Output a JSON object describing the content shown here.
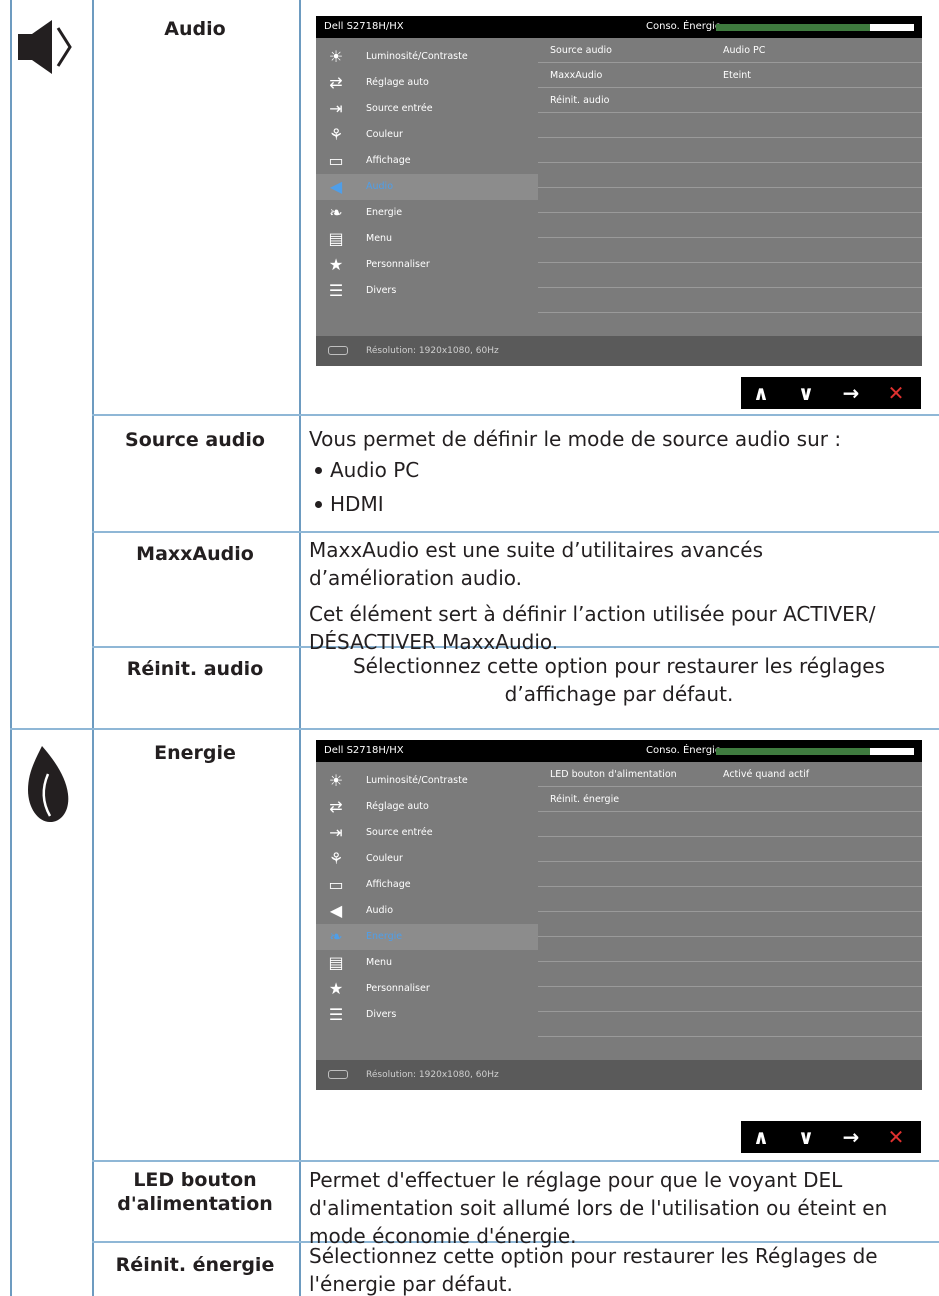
{
  "audio_section": {
    "title": "Audio",
    "osd": {
      "model": "Dell S2718H/HX",
      "energy_label": "Conso. Énergie",
      "energy_level": 0.78,
      "menu_items": [
        {
          "icon": "brightness-icon",
          "label": "Luminosité/Contraste"
        },
        {
          "icon": "auto-adjust-icon",
          "label": "Réglage auto"
        },
        {
          "icon": "input-source-icon",
          "label": "Source entrée"
        },
        {
          "icon": "color-icon",
          "label": "Couleur"
        },
        {
          "icon": "display-icon",
          "label": "Affichage"
        },
        {
          "icon": "speaker-icon",
          "label": "Audio"
        },
        {
          "icon": "energy-icon",
          "label": "Energie"
        },
        {
          "icon": "menu-icon",
          "label": "Menu"
        },
        {
          "icon": "star-icon",
          "label": "Personnaliser"
        },
        {
          "icon": "others-icon",
          "label": "Divers"
        }
      ],
      "active_index": 5,
      "settings": [
        {
          "name": "Source audio",
          "value": "Audio PC"
        },
        {
          "name": "MaxxAudio",
          "value": "Eteint"
        },
        {
          "name": "Réinit. audio",
          "value": ""
        }
      ],
      "resolution": "Résolution: 1920x1080, 60Hz"
    },
    "rows": [
      {
        "label": "Source audio",
        "intro": "Vous permet de définir le mode de source audio sur :",
        "bullets": [
          "Audio PC",
          "HDMI"
        ]
      },
      {
        "label": "MaxxAudio",
        "para1": "MaxxAudio est une suite d’utilitaires avancés d’amélioration audio.",
        "para2": "Cet élément sert à définir l’action utilisée pour ACTIVER/ DÉSACTIVER MaxxAudio."
      },
      {
        "label": "Réinit. audio",
        "text": "Sélectionnez cette option pour restaurer les réglages d’affichage par défaut."
      }
    ]
  },
  "energy_section": {
    "title": "Energie",
    "osd": {
      "model": "Dell S2718H/HX",
      "energy_label": "Conso. Énergie",
      "energy_level": 0.78,
      "active_index": 6,
      "settings": [
        {
          "name": "LED bouton d'alimentation",
          "value": "Activé quand actif"
        },
        {
          "name": "Réinit. énergie",
          "value": ""
        }
      ],
      "resolution": "Résolution: 1920x1080, 60Hz"
    },
    "rows": [
      {
        "label": "LED bouton d'alimentation",
        "text": "Permet d'effectuer le réglage pour que le voyant DEL d'alimentation soit allumé lors de l'utilisation ou éteint en mode économie d'énergie."
      },
      {
        "label": "Réinit. énergie",
        "text": "Sélectionnez cette option pour restaurer les Réglages de l'énergie par défaut."
      }
    ]
  },
  "nav_buttons": [
    "up-icon",
    "down-icon",
    "right-arrow-icon",
    "close-icon"
  ],
  "colors": {
    "grid": "#6d9bc0",
    "active_menu_text": "#4f9ee8",
    "energy_bar": "#3f7b3f",
    "close": "#e0312f"
  }
}
